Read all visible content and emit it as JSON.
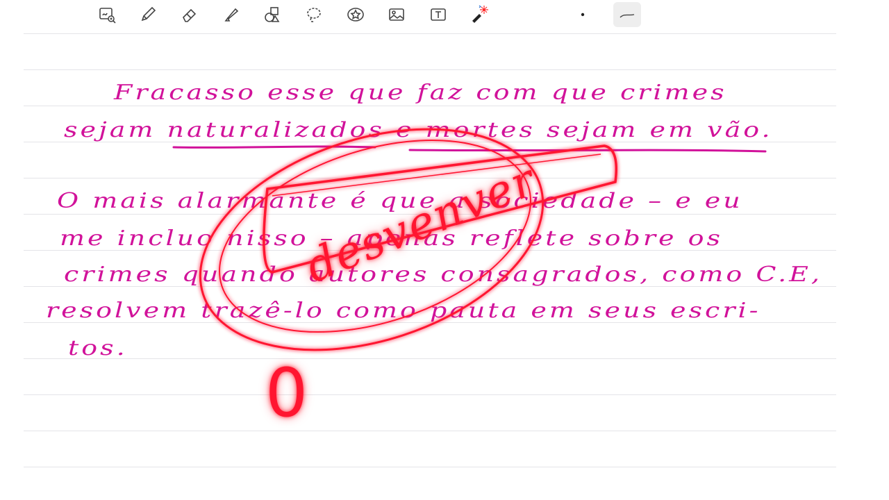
{
  "toolbar": {
    "tools": [
      {
        "name": "lasso-zoom-tool",
        "icon": "zoom-lasso-icon"
      },
      {
        "name": "pen-tool",
        "icon": "pen-icon"
      },
      {
        "name": "eraser-tool",
        "icon": "eraser-icon"
      },
      {
        "name": "highlighter-tool",
        "icon": "highlighter-icon"
      },
      {
        "name": "shapes-tool",
        "icon": "shapes-icon"
      },
      {
        "name": "lasso-tool",
        "icon": "lasso-icon"
      },
      {
        "name": "sticker-tool",
        "icon": "star-sticker-icon"
      },
      {
        "name": "image-tool",
        "icon": "image-icon"
      },
      {
        "name": "text-tool",
        "icon": "text-box-icon"
      },
      {
        "name": "laser-pointer-tool",
        "icon": "laser-pointer-icon"
      }
    ],
    "stroke_options": [
      {
        "name": "stroke-size-dot",
        "icon": "dot-icon"
      },
      {
        "name": "stroke-style-curve",
        "icon": "curve-stroke-icon",
        "selected": true
      }
    ]
  },
  "note": {
    "ink_color": "#d1129a",
    "stamp_color": "#ff1530",
    "lines": [
      "Fracasso esse que faz com que crimes",
      "sejam naturalizados e mortes sejam em vão.",
      "O mais alarmante é que a sociedade – e eu",
      "me incluo nisso – apenas reflete sobre os",
      "crimes quando autores consagrados, como C.E,",
      "resolvem trazê-lo como pauta em seus escri-",
      "tos."
    ],
    "stamp_word": "desvenver",
    "paragraph_number": "0"
  }
}
